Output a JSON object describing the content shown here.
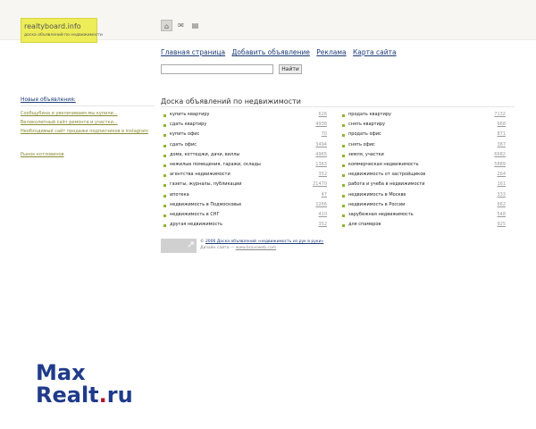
{
  "logo": {
    "name": "realtyboard.info",
    "tagline": "доска объявлений по недвижимости"
  },
  "top_icons": [
    "home-icon",
    "mail-icon",
    "page-icon"
  ],
  "nav": [
    "Главная страница",
    "Добавить объявление",
    "Реклама",
    "Карта сайта"
  ],
  "search": {
    "value": "",
    "button": "Найти"
  },
  "left": {
    "heading": "Новые объявления:",
    "items": [
      "Сообщубина и увеличиваем мы купили...",
      "Великолепный сайт ремонта и участки...",
      "Необходимый сайт продажи подписчиков в instagram"
    ],
    "bottom": "Рынок котловинов"
  },
  "page_title": "Доска объявлений по недвижимости",
  "categories_left": [
    {
      "label": "купить квартиру",
      "count": "626"
    },
    {
      "label": "сдать квартиру",
      "count": "4938"
    },
    {
      "label": "купить офис",
      "count": "70"
    },
    {
      "label": "сдать офис",
      "count": "3494"
    },
    {
      "label": "дома, коттеджи, дачи, виллы",
      "count": "4965"
    },
    {
      "label": "нежилые помещения, гаражи, склады",
      "count": "1363"
    },
    {
      "label": "агентства недвижимости",
      "count": "352"
    },
    {
      "label": "газеты, журналы, публикации",
      "count": "21470"
    },
    {
      "label": "ипотека",
      "count": "47"
    },
    {
      "label": "недвижимость в Подмосковье",
      "count": "1266"
    },
    {
      "label": "недвижимость в СНГ",
      "count": "410"
    },
    {
      "label": "другая недвижимость",
      "count": "352"
    }
  ],
  "categories_right": [
    {
      "label": "продать квартиру",
      "count": "7132"
    },
    {
      "label": "снять квартиру",
      "count": "668"
    },
    {
      "label": "продать офис",
      "count": "871"
    },
    {
      "label": "снять офис",
      "count": "387"
    },
    {
      "label": "земля, участки",
      "count": "6682"
    },
    {
      "label": "коммерческая недвижимость",
      "count": "5889"
    },
    {
      "label": "недвижимость от застройщиков",
      "count": "264"
    },
    {
      "label": "работа и учеба в недвижимости",
      "count": "161"
    },
    {
      "label": "недвижимость в Москве",
      "count": "333"
    },
    {
      "label": "недвижимость в России",
      "count": "662"
    },
    {
      "label": "зарубежная недвижимость",
      "count": "548"
    },
    {
      "label": "для спамеров",
      "count": "925"
    }
  ],
  "footer": {
    "line1_prefix": "© ",
    "line1_link": "2006 Доска объявлений «недвижимость из рук в руки»",
    "line2_prefix": "Дизайн сайта — ",
    "line2_link": "www.bravoweb.com"
  },
  "watermark": {
    "line1": "Max",
    "line2": "Realt",
    "dot": ".",
    "line2b": "ru"
  },
  "colors": {
    "accent": "#8db52b",
    "link": "#1a3a78",
    "logo_bg": "#eded5a"
  }
}
